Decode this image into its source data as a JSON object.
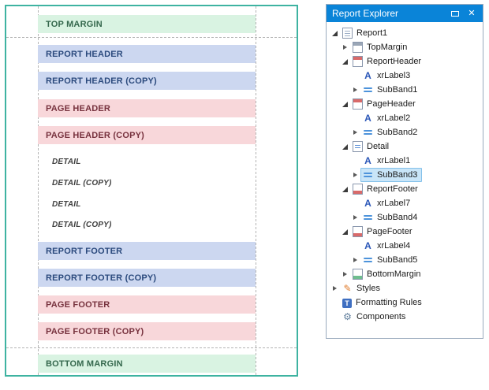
{
  "designer": {
    "bands": [
      {
        "label": "TOP MARGIN",
        "type": "margin"
      },
      {
        "label": "REPORT HEADER",
        "type": "report"
      },
      {
        "label": "REPORT HEADER (COPY)",
        "type": "report"
      },
      {
        "label": "PAGE HEADER",
        "type": "page"
      },
      {
        "label": "PAGE HEADER (COPY)",
        "type": "page"
      },
      {
        "label": "DETAIL",
        "type": "detail"
      },
      {
        "label": "DETAIL (COPY)",
        "type": "detail"
      },
      {
        "label": "DETAIL",
        "type": "detail"
      },
      {
        "label": "DETAIL (COPY)",
        "type": "detail"
      },
      {
        "label": "REPORT FOOTER",
        "type": "report"
      },
      {
        "label": "REPORT FOOTER (COPY)",
        "type": "report"
      },
      {
        "label": "PAGE FOOTER",
        "type": "page"
      },
      {
        "label": "PAGE FOOTER (COPY)",
        "type": "page"
      },
      {
        "label": "BOTTOM MARGIN",
        "type": "margin"
      }
    ]
  },
  "explorer": {
    "title": "Report Explorer",
    "close_glyph": "✕",
    "icon_glyphs": {
      "label": "A",
      "formatting": "T"
    },
    "tree": [
      {
        "label": "Report1",
        "depth": 0,
        "icon": "report-document-icon",
        "state": "expanded"
      },
      {
        "label": "TopMargin",
        "depth": 1,
        "icon": "top-margin-band-icon",
        "state": "collapsed"
      },
      {
        "label": "ReportHeader",
        "depth": 1,
        "icon": "report-header-band-icon",
        "state": "expanded"
      },
      {
        "label": "xrLabel3",
        "depth": 2,
        "icon": "label-a-icon",
        "state": "leaf"
      },
      {
        "label": "SubBand1",
        "depth": 2,
        "icon": "subband-lines-icon",
        "state": "collapsed"
      },
      {
        "label": "PageHeader",
        "depth": 1,
        "icon": "page-header-band-icon",
        "state": "expanded"
      },
      {
        "label": "xrLabel2",
        "depth": 2,
        "icon": "label-a-icon",
        "state": "leaf"
      },
      {
        "label": "SubBand2",
        "depth": 2,
        "icon": "subband-lines-icon",
        "state": "collapsed"
      },
      {
        "label": "Detail",
        "depth": 1,
        "icon": "detail-band-icon",
        "state": "expanded"
      },
      {
        "label": "xrLabel1",
        "depth": 2,
        "icon": "label-a-icon",
        "state": "leaf"
      },
      {
        "label": "SubBand3",
        "depth": 2,
        "icon": "subband-lines-icon",
        "state": "collapsed",
        "selected": true
      },
      {
        "label": "ReportFooter",
        "depth": 1,
        "icon": "report-footer-band-icon",
        "state": "expanded"
      },
      {
        "label": "xrLabel7",
        "depth": 2,
        "icon": "label-a-icon",
        "state": "leaf"
      },
      {
        "label": "SubBand4",
        "depth": 2,
        "icon": "subband-lines-icon",
        "state": "collapsed"
      },
      {
        "label": "PageFooter",
        "depth": 1,
        "icon": "page-footer-band-icon",
        "state": "expanded"
      },
      {
        "label": "xrLabel4",
        "depth": 2,
        "icon": "label-a-icon",
        "state": "leaf"
      },
      {
        "label": "SubBand5",
        "depth": 2,
        "icon": "subband-lines-icon",
        "state": "collapsed"
      },
      {
        "label": "BottomMargin",
        "depth": 1,
        "icon": "bottom-margin-band-icon",
        "state": "collapsed"
      },
      {
        "label": "Styles",
        "depth": 0,
        "icon": "styles-pencil-icon",
        "state": "collapsed"
      },
      {
        "label": "Formatting Rules",
        "depth": 0,
        "icon": "formatting-rules-icon",
        "state": "leaf"
      },
      {
        "label": "Components",
        "depth": 0,
        "icon": "components-gear-icon",
        "state": "leaf"
      }
    ]
  },
  "colors": {
    "surfaceBorder": "#3eb3a1",
    "bandReportBg": "#ccd7f0",
    "bandReportFg": "#2b4a7d",
    "bandPageBg": "#f8d7da",
    "bandPageFg": "#77323e",
    "bandMarginBg": "#d9f3e2",
    "bandMarginFg": "#35684d",
    "detailFg": "#3f3f3f",
    "titleBg": "#0a84d8",
    "titleFg": "#ffffff",
    "selectionBg": "#c9e5f8",
    "panelBorder": "#9aabbd",
    "guide": "#b4b4b4",
    "treeFg": "#1a1a1a"
  }
}
